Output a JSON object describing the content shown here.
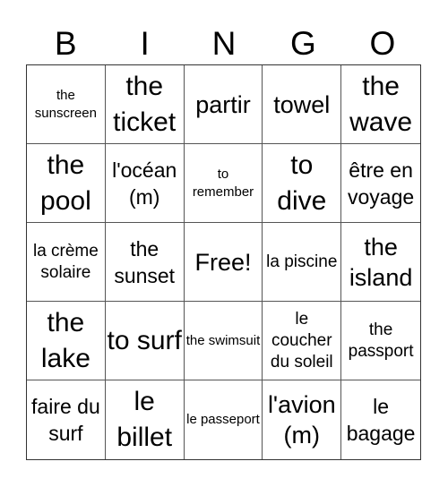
{
  "header": [
    "B",
    "I",
    "N",
    "G",
    "O"
  ],
  "cells": [
    {
      "text": "the sunscreen",
      "size": "xs"
    },
    {
      "text": "the ticket",
      "size": "xl"
    },
    {
      "text": "partir",
      "size": "lg"
    },
    {
      "text": "towel",
      "size": "lg"
    },
    {
      "text": "the wave",
      "size": "xl"
    },
    {
      "text": "the pool",
      "size": "xl"
    },
    {
      "text": "l'océan (m)",
      "size": "md"
    },
    {
      "text": "to remember",
      "size": "xs"
    },
    {
      "text": "to dive",
      "size": "xl"
    },
    {
      "text": "être en voyage",
      "size": "md"
    },
    {
      "text": "la crème solaire",
      "size": "sm"
    },
    {
      "text": "the sunset",
      "size": "md"
    },
    {
      "text": "Free!",
      "size": "lg"
    },
    {
      "text": "la piscine",
      "size": "sm"
    },
    {
      "text": "the island",
      "size": "lg"
    },
    {
      "text": "the lake",
      "size": "xl"
    },
    {
      "text": "to surf",
      "size": "xl"
    },
    {
      "text": "the swimsuit",
      "size": "xs"
    },
    {
      "text": "le coucher du soleil",
      "size": "sm"
    },
    {
      "text": "the passport",
      "size": "sm"
    },
    {
      "text": "faire du surf",
      "size": "md"
    },
    {
      "text": "le billet",
      "size": "xl"
    },
    {
      "text": "le passeport",
      "size": "xs"
    },
    {
      "text": "l'avion (m)",
      "size": "lg"
    },
    {
      "text": "le bagage",
      "size": "md"
    }
  ]
}
